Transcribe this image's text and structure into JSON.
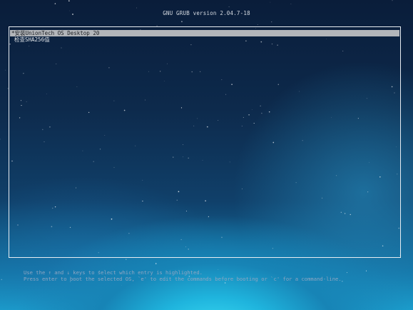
{
  "header": {
    "title": "GNU GRUB  version 2.04.7-18"
  },
  "menu": {
    "entries": [
      {
        "label": "*安装UnionTech OS Desktop 20",
        "selected": true
      },
      {
        "label": "检查SHA256值",
        "selected": false
      }
    ]
  },
  "help": {
    "line1": "Use the ↑ and ↓ keys to select which entry is highlighted.",
    "line2": "Press enter to boot the selected OS, `e' to edit the commands before booting or `c' for a command-line."
  },
  "colors": {
    "selection_bg": "#b3b6ba",
    "text": "#e2e6ea",
    "border": "#e8edf2",
    "help_text": "#8fa6c2"
  }
}
